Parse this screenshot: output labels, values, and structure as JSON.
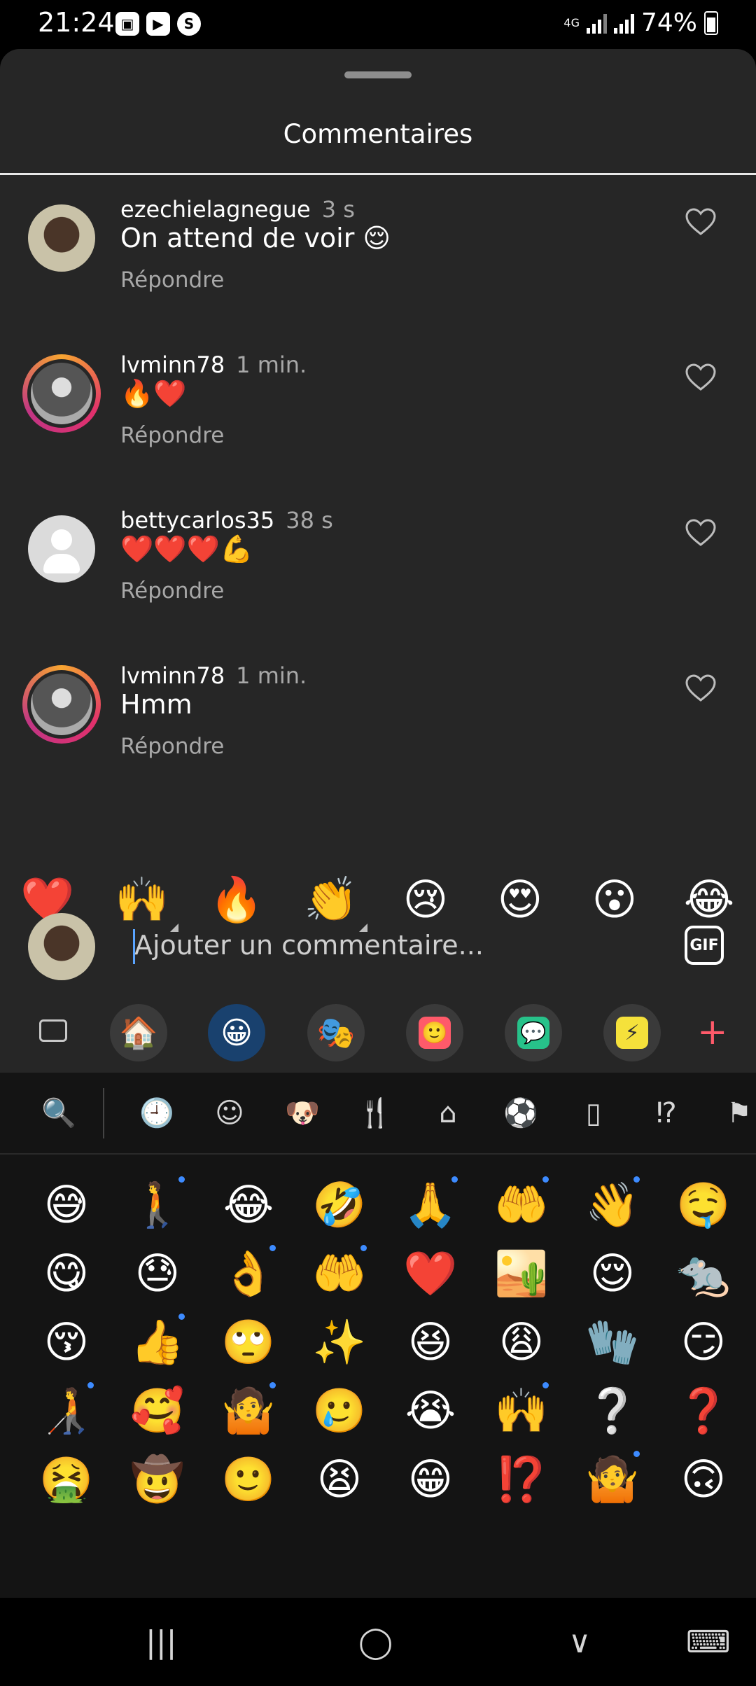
{
  "status": {
    "time": "21:24",
    "network": "4G",
    "battery": "74%"
  },
  "sheet": {
    "title": "Commentaires"
  },
  "comments": [
    {
      "user": "ezechielagnegue",
      "time": "3 s",
      "text": "On attend de voir 😌",
      "reply": "Répondre"
    },
    {
      "user": "lvminn78",
      "time": "1 min.",
      "text": "🔥❤️",
      "reply": "Répondre"
    },
    {
      "user": "bettycarlos35",
      "time": "38 s",
      "text": "❤️❤️❤️💪",
      "reply": "Répondre"
    },
    {
      "user": "lvminn78",
      "time": "1 min.",
      "text": "Hmm",
      "reply": "Répondre"
    }
  ],
  "reactions": [
    "❤️",
    "🙌",
    "🔥",
    "👏",
    "😢",
    "😍",
    "😮",
    "😂"
  ],
  "input": {
    "placeholder": "Ajouter un commentaire...",
    "gif_label": "GIF"
  },
  "keyboard": {
    "toolbar": [
      "🏠",
      "😀",
      "🎭",
      "🙂",
      "💬",
      "⚡"
    ],
    "plus": "+",
    "categories": [
      "🔍",
      "🕘",
      "☺",
      "🐶",
      "🍴",
      "⌂",
      "⚽",
      "▯",
      "⁉",
      "⚑"
    ],
    "recent_emojis": [
      "😅",
      "🚶",
      "😂",
      "🤣",
      "🙏",
      "🤲",
      "👋",
      "🤤",
      "😋",
      "😓",
      "👌",
      "🤲",
      "❤️",
      "🏜️",
      "😌",
      "🐀",
      "😚",
      "👍",
      "🙄",
      "✨",
      "😆",
      "😩",
      "🧤",
      "😏",
      "🧑‍🦯",
      "🥰",
      "🤷",
      "🥲",
      "😭",
      "🙌",
      "❔",
      "❓",
      "🤮",
      "🤠",
      "🙂",
      "😫",
      "😁",
      "⁉️",
      "🤷",
      "🙃"
    ]
  },
  "navbar": {
    "recents": "|||",
    "home": "◯",
    "back": "∨",
    "keyboard": "⌨"
  }
}
